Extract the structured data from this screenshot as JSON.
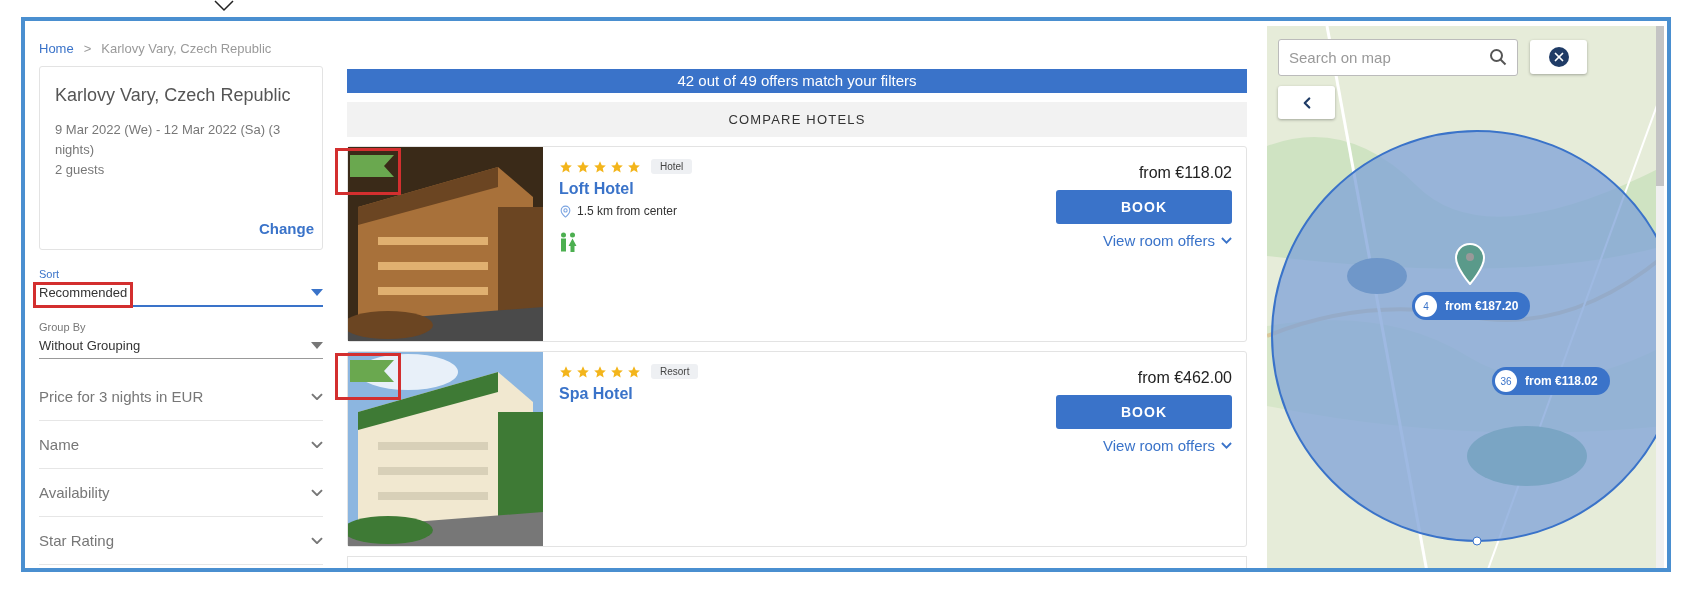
{
  "breadcrumb": [
    {
      "label": "Home",
      "link": true
    },
    {
      "label": ">",
      "link": false
    },
    {
      "label": "Karlovy Vary, Czech Republic",
      "link": false
    }
  ],
  "search_summary": {
    "title": "Karlovy Vary, Czech Republic",
    "dates": "9 Mar 2022 (We) - 12 Mar 2022 (Sa) (3 nights)",
    "guests": "2 guests",
    "action": "Change"
  },
  "selects": [
    {
      "label": "Sort",
      "value": "Recommended",
      "focused": true,
      "highlighted": true
    },
    {
      "label": "Group By",
      "value": "Without Grouping",
      "focused": false,
      "highlighted": false
    }
  ],
  "filters": [
    {
      "label": "Price for 3 nights in EUR",
      "expanded": false
    },
    {
      "label": "Name",
      "expanded": false
    },
    {
      "label": "Availability",
      "expanded": false
    },
    {
      "label": "Star Rating",
      "expanded": false
    }
  ],
  "results_banner": "42 out of 49 offers match your filters",
  "compare_button": "COMPARE HOTELS",
  "hotels": [
    {
      "name": "Loft Hotel",
      "stars": 5,
      "type": "Hotel",
      "distance": "1.5 km from center",
      "family": true,
      "price": "from €118.02",
      "book": "BOOK",
      "offers": "View room offers",
      "flag_highlighted": true
    },
    {
      "name": "Spa Hotel",
      "stars": 5,
      "type": "Resort",
      "family": false,
      "price": "from €462.00",
      "book": "BOOK",
      "offers": "View room offers",
      "flag_highlighted": true
    }
  ],
  "map": {
    "search_placeholder": "Search on map",
    "markers": [
      {
        "count": "4",
        "price": "from €187.20"
      },
      {
        "count": "36",
        "price": "from €118.02"
      }
    ]
  }
}
